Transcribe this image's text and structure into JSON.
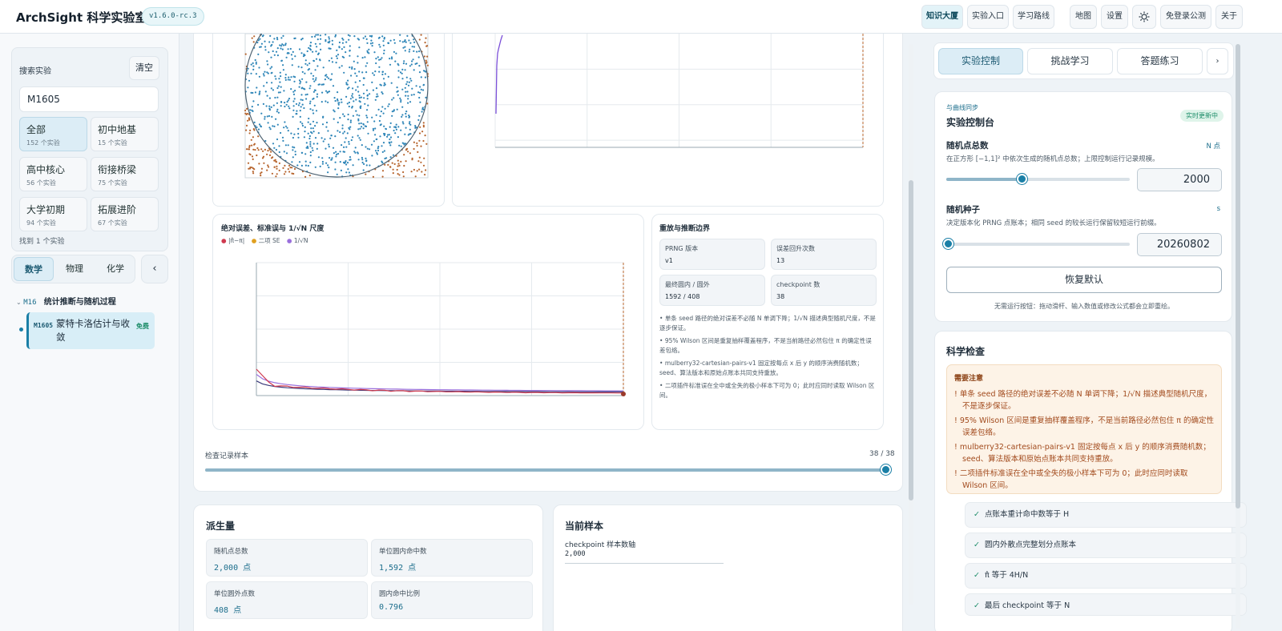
{
  "header": {
    "title": "ArchSight 科学实验室",
    "version": "v1.6.0-rc.3",
    "nav": [
      "知识大厦",
      "实验入口",
      "学习路线"
    ],
    "right": [
      "地图",
      "设置",
      "免登录公测",
      "关于"
    ]
  },
  "sidebar": {
    "search_label": "搜索实验",
    "clear": "清空",
    "search_value": "M1605",
    "cats": [
      {
        "n": "全部",
        "c": "152 个实验"
      },
      {
        "n": "初中地基",
        "c": "15 个实验"
      },
      {
        "n": "高中核心",
        "c": "56 个实验"
      },
      {
        "n": "衔接桥梁",
        "c": "75 个实验"
      },
      {
        "n": "大学初期",
        "c": "94 个实验"
      },
      {
        "n": "拓展进阶",
        "c": "67 个实验"
      }
    ],
    "found": "找到 1 个实验",
    "subjects": [
      "数学",
      "物理",
      "化学"
    ],
    "collapse": "‹",
    "group_code": "M16",
    "group_title": "统计推断与随机过程",
    "item_code": "M1605",
    "item_title": "蒙特卡洛估计与收敛",
    "item_badge": "免费"
  },
  "center": {
    "err_title": "绝对误差、标准误与 1/√N 尺度",
    "legend": [
      "|π̂−π|",
      "二项 SE",
      "1/√N"
    ],
    "replay_title": "重放与推断边界",
    "minis": [
      {
        "l": "PRNG 版本",
        "v": "v1"
      },
      {
        "l": "误差回升次数",
        "v": "13"
      },
      {
        "l": "最终圆内 / 圆外",
        "v": "1592 / 408"
      },
      {
        "l": "checkpoint 数",
        "v": "38"
      }
    ],
    "notes": [
      "单条 seed 路径的绝对误差不必随 N 单调下降；1/√N 描述典型随机尺度，不是逐步保证。",
      "95% Wilson 区间是重复抽样覆盖程序，不是当前路径必然包住 π 的确定性误差包络。",
      "mulberry32-cartesian-pairs-v1 固定按每点 x 后 y 的顺序消费随机数；seed、算法版本和原始点账本共同支持重放。",
      "二项插件标准误在全中或全失的极小样本下可为 0；此时应同时读取 Wilson 区间。"
    ],
    "slider_label": "检查记录样本",
    "slider_value": "38 / 38",
    "slider_fraction": 1.0,
    "derived_title": "派生量",
    "derived": [
      {
        "l": "随机点总数",
        "v": "2,000",
        "u": "点"
      },
      {
        "l": "单位圆内命中数",
        "v": "1,592",
        "u": "点"
      },
      {
        "l": "单位圆外点数",
        "v": "408",
        "u": "点"
      },
      {
        "l": "圆内命中比例",
        "v": "0.796",
        "u": ""
      }
    ],
    "sample_title": "当前样本",
    "sample_label": "checkpoint 样本数轴",
    "sample_value": "2,000"
  },
  "right": {
    "tabs": [
      "实验控制",
      "挑战学习",
      "答题练习"
    ],
    "tab_more": "›",
    "sync": "与曲线同步",
    "panel_title": "实验控制台",
    "live": "实时更新中",
    "p1_label": "随机点总数",
    "p1_sym": "N 点",
    "p1_desc": "在正方形 [−1,1]² 中依次生成的随机点总数；上限控制运行记录规模。",
    "p1_value": "2000",
    "p1_fraction": 0.4,
    "p2_label": "随机种子",
    "p2_sym": "s",
    "p2_desc": "决定版本化 PRNG 点账本；相同 seed 的较长运行保留较短运行前缀。",
    "p2_value": "20260802",
    "p2_fraction": 0.0,
    "reset": "恢复默认",
    "hint": "无需运行按钮：拖动滑杆、输入数值或修改公式都会立即重绘。",
    "sci_title": "科学检查",
    "warn_title": "需要注意",
    "warns": [
      "单条 seed 路径的绝对误差不必随 N 单调下降；1/√N 描述典型随机尺度，不是逐步保证。",
      "95% Wilson 区间是重复抽样覆盖程序，不是当前路径必然包住 π 的确定性误差包络。",
      "mulberry32-cartesian-pairs-v1 固定按每点 x 后 y 的顺序消费随机数；seed、算法版本和原始点账本共同支持重放。",
      "二项插件标准误在全中或全失的极小样本下可为 0；此时应同时读取 Wilson 区间。"
    ],
    "checks": [
      "点账本重计命中数等于 H",
      "圆内外散点完整划分点账本",
      "π̂ 等于 4H/N",
      "最后 checkpoint 等于 N"
    ]
  },
  "colors": {
    "accent": "#1a7fa6",
    "inside": "#2f86b8",
    "outside": "#b7652e",
    "err": "#cf3a4f",
    "se": "#e0a020",
    "inv": "#9a6fdc"
  }
}
